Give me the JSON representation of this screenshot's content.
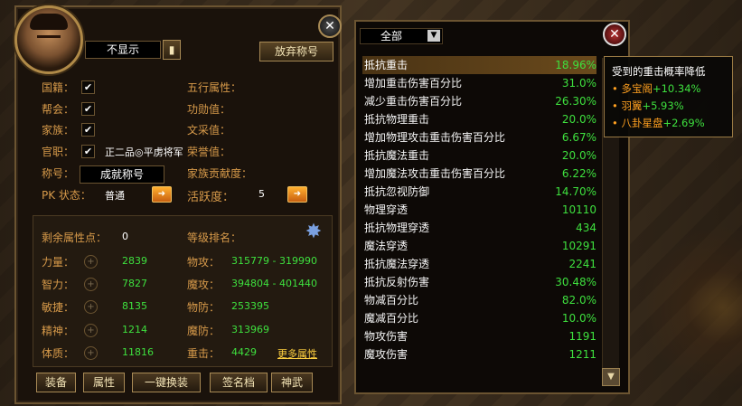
{
  "left": {
    "title_display": "不显示",
    "abandon_title_button": "放弃称号",
    "toggles": [
      {
        "label": "国籍：",
        "checked": "✔"
      },
      {
        "label": "帮会：",
        "checked": "✔"
      },
      {
        "label": "家族：",
        "checked": "✔"
      },
      {
        "label": "官职：",
        "checked": "✔",
        "value": "正二品◎平虏将军"
      }
    ],
    "title_label": "称号：",
    "title_value": "成就称号",
    "pk_label": "PK 状态：",
    "pk_value": "普通",
    "right_labels": [
      "五行属性：",
      "功勋值：",
      "文采值：",
      "荣誉值：",
      "家族贡献度："
    ],
    "activity_label": "活跃度：",
    "activity_value": "5",
    "free_points_label": "剩余属性点：",
    "free_points_value": "0",
    "level_rank_label": "等级排名：",
    "attrs": [
      {
        "label": "力量：",
        "value": "2839"
      },
      {
        "label": "智力：",
        "value": "7827"
      },
      {
        "label": "敏捷：",
        "value": "8135"
      },
      {
        "label": "精神：",
        "value": "1214"
      },
      {
        "label": "体质：",
        "value": "11816"
      }
    ],
    "combat": [
      {
        "label": "物攻：",
        "value": "315779 - 319990"
      },
      {
        "label": "魔攻：",
        "value": "394804 - 401440"
      },
      {
        "label": "物防：",
        "value": "253395"
      },
      {
        "label": "魔防：",
        "value": "313969"
      },
      {
        "label": "重击：",
        "value": "4429"
      }
    ],
    "more_attrs": "更多属性",
    "tabs": [
      "装备",
      "属性",
      "一键换装",
      "签名档",
      "神武"
    ]
  },
  "right": {
    "filter_value": "全部",
    "stats": [
      {
        "name": "抵抗重击",
        "value": "18.96%"
      },
      {
        "name": "增加重击伤害百分比",
        "value": "31.0%"
      },
      {
        "name": "减少重击伤害百分比",
        "value": "26.30%"
      },
      {
        "name": "抵抗物理重击",
        "value": "20.0%"
      },
      {
        "name": "增加物理攻击重击伤害百分比",
        "value": "6.67%"
      },
      {
        "name": "抵抗魔法重击",
        "value": "20.0%"
      },
      {
        "name": "增加魔法攻击重击伤害百分比",
        "value": "6.22%"
      },
      {
        "name": "抵抗忽视防御",
        "value": "14.70%"
      },
      {
        "name": "物理穿透",
        "value": "10110"
      },
      {
        "name": "抵抗物理穿透",
        "value": "434"
      },
      {
        "name": "魔法穿透",
        "value": "10291"
      },
      {
        "name": "抵抗魔法穿透",
        "value": "2241"
      },
      {
        "name": "抵抗反射伤害",
        "value": "30.48%"
      },
      {
        "name": "物减百分比",
        "value": "82.0%"
      },
      {
        "name": "魔减百分比",
        "value": "10.0%"
      },
      {
        "name": "物攻伤害",
        "value": "1191"
      },
      {
        "name": "魔攻伤害",
        "value": "1211"
      }
    ]
  },
  "tooltip": {
    "title": "受到的重击概率降低",
    "items": [
      {
        "name": "多宝阁",
        "value": "+10.34%"
      },
      {
        "name": "羽翼",
        "value": "+5.93%"
      },
      {
        "name": "八卦星盘",
        "value": "+2.69%"
      }
    ]
  },
  "icons": {
    "close": "close-icon",
    "arrow": "arrow-right-icon",
    "dropdown": "chevron-down-icon",
    "scroll_down": "scroll-down-icon",
    "medal": "medal-icon"
  }
}
